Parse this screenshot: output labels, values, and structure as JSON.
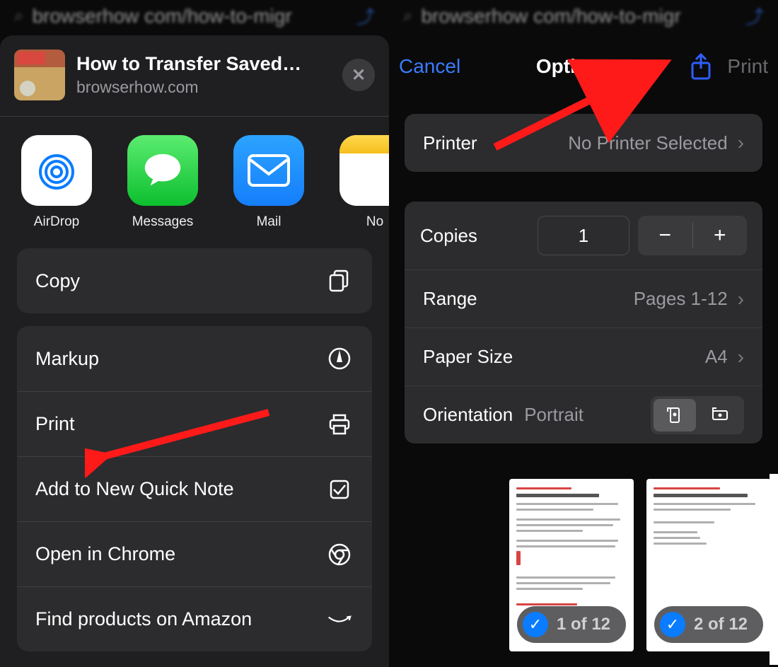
{
  "left": {
    "address_url": "browserhow com/how-to-migr",
    "sheet": {
      "title": "How to Transfer Saved…",
      "domain": "browserhow.com"
    },
    "apps": [
      {
        "label": "AirDrop",
        "icon": "airdrop-icon"
      },
      {
        "label": "Messages",
        "icon": "messages-icon"
      },
      {
        "label": "Mail",
        "icon": "mail-icon"
      },
      {
        "label": "No",
        "icon": "notes-icon"
      }
    ],
    "actions_group1": [
      {
        "label": "Copy",
        "icon": "copy-icon"
      }
    ],
    "actions_group2": [
      {
        "label": "Markup",
        "icon": "markup-icon"
      },
      {
        "label": "Print",
        "icon": "print-icon"
      },
      {
        "label": "Add to New Quick Note",
        "icon": "quicknote-icon"
      },
      {
        "label": "Open in Chrome",
        "icon": "chrome-icon"
      },
      {
        "label": "Find products on Amazon",
        "icon": "amazon-icon"
      }
    ]
  },
  "right": {
    "address_url": "browserhow com/how-to-migr",
    "header": {
      "cancel": "Cancel",
      "title": "Options",
      "print": "Print"
    },
    "printer": {
      "label": "Printer",
      "value": "No Printer Selected"
    },
    "copies": {
      "label": "Copies",
      "value": "1"
    },
    "range": {
      "label": "Range",
      "value": "Pages 1-12"
    },
    "paper": {
      "label": "Paper Size",
      "value": "A4"
    },
    "orientation": {
      "label": "Orientation",
      "value": "Portrait"
    },
    "previews": [
      {
        "label": "1 of 12"
      },
      {
        "label": "2 of 12"
      }
    ]
  }
}
